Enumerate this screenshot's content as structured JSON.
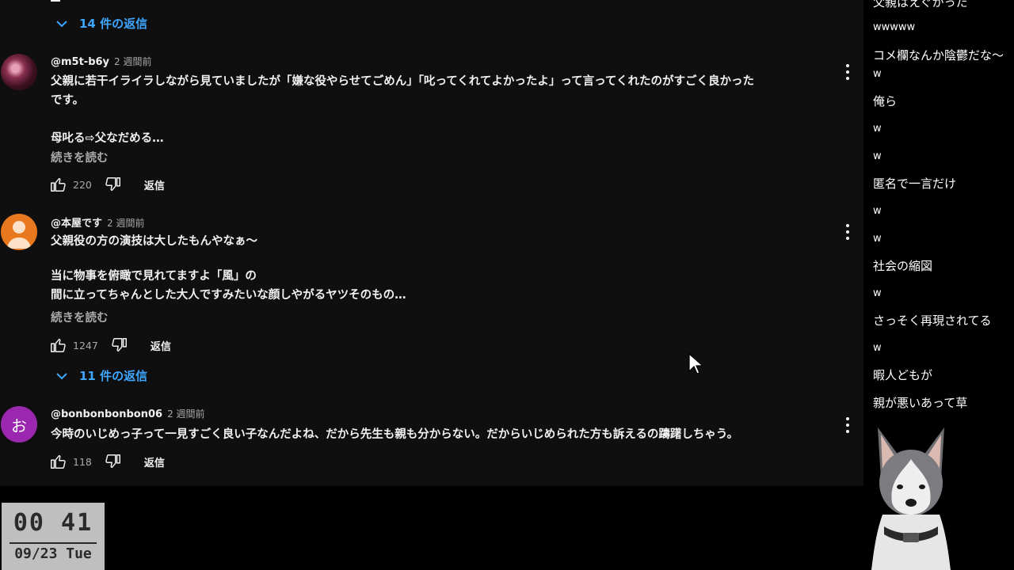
{
  "comments": {
    "top_replies_toggle": "14 件の返信",
    "items": [
      {
        "author": "@m5t-b6y",
        "time": "2 週間前",
        "text_lines": [
          "父親に若干イライラしながら見ていましたが「嫌な役やらせてごめん」「叱ってくれてよかったよ」って言ってくれたのがすごく良かった",
          "です。",
          "",
          "母叱る⇨父なだめる…"
        ],
        "read_more": "続きを読む",
        "likes": "220",
        "reply": "返信"
      },
      {
        "author": "@本屋です",
        "time": "2 週間前",
        "text_lines": [
          "父親役の方の演技は大したもんやなぁ～",
          "",
          "当に物事を俯瞰で見れてますよ「風」の",
          "間に立ってちゃんとした大人ですみたいな顔しやがるヤツそのもの…"
        ],
        "read_more": "続きを読む",
        "likes": "1247",
        "reply": "返信",
        "replies_toggle": "11 件の返信"
      },
      {
        "author": "@bonbonbonbon06",
        "time": "2 週間前",
        "avatar_letter": "お",
        "text_lines": [
          "今時のいじめっ子って一見すごく良い子なんだよね、だから先生も親も分からない。だからいじめられた方も訴えるの躊躇しちゃう。"
        ],
        "likes": "118",
        "reply": "返信"
      }
    ]
  },
  "chat": [
    "父親はえぐかった",
    "wwwww",
    "コメ欄なんか陰鬱だな～",
    "w",
    "俺ら",
    "w",
    "w",
    "匿名で一言だけ",
    "w",
    "w",
    "社会の縮図",
    "w",
    "さっそく再現されてる",
    "w",
    "暇人どもが",
    "親が悪いあって草"
  ],
  "clock": {
    "time": "00 41",
    "date": "09/23 Tue"
  },
  "colors": {
    "accent": "#3ea6ff",
    "panel": "#0f0f0f",
    "secondary_text": "#aaaaaa"
  }
}
